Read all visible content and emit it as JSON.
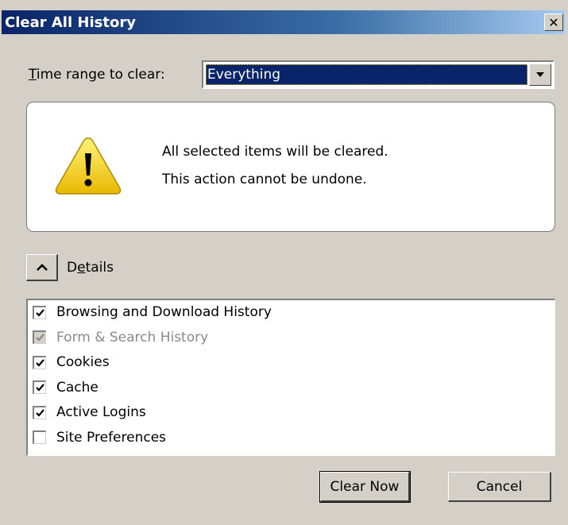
{
  "window": {
    "title": "Clear All History",
    "close_icon": "close-icon"
  },
  "time_range": {
    "label": "Time range to clear:",
    "selected": "Everything"
  },
  "warning": {
    "icon": "warning-icon",
    "line1": "All selected items will be cleared.",
    "line2": "This action cannot be undone."
  },
  "details": {
    "toggle_icon": "chevron-up-icon",
    "label": "Details"
  },
  "items": [
    {
      "label": "Browsing and Download History",
      "checked": true,
      "enabled": true
    },
    {
      "label": "Form & Search History",
      "checked": true,
      "enabled": false
    },
    {
      "label": "Cookies",
      "checked": true,
      "enabled": true
    },
    {
      "label": "Cache",
      "checked": true,
      "enabled": true
    },
    {
      "label": "Active Logins",
      "checked": true,
      "enabled": true
    },
    {
      "label": "Site Preferences",
      "checked": false,
      "enabled": true
    }
  ],
  "buttons": {
    "clear_now": "Clear Now",
    "cancel": "Cancel"
  },
  "colors": {
    "title_gradient_start": "#0a246a",
    "dialog_bg": "#d4d0c8",
    "selection": "#0a246a",
    "warning_yellow": "#f5d800"
  }
}
